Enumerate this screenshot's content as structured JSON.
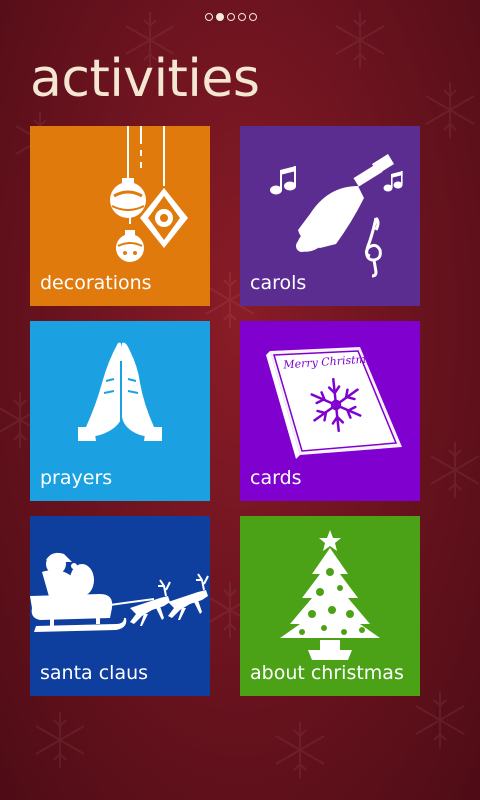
{
  "pager": {
    "count": 5,
    "active_index": 1
  },
  "page": {
    "title": "activities"
  },
  "tiles": [
    {
      "label": "decorations",
      "color": "#e07a0d",
      "icon": "ornaments-icon"
    },
    {
      "label": "carols",
      "color": "#5c2d91",
      "icon": "bell-music-icon"
    },
    {
      "label": "prayers",
      "color": "#1ba1e2",
      "icon": "praying-hands-icon"
    },
    {
      "label": "cards",
      "color": "#7f00cf",
      "icon": "christmas-card-icon"
    },
    {
      "label": "santa claus",
      "color": "#0f3f9e",
      "icon": "santa-sleigh-icon"
    },
    {
      "label": "about christmas",
      "color": "#4ca216",
      "icon": "christmas-tree-icon"
    }
  ],
  "card_text": "Merry Christmas",
  "colors": {
    "background": "#6e1420",
    "title_text": "#f3e7d2"
  }
}
